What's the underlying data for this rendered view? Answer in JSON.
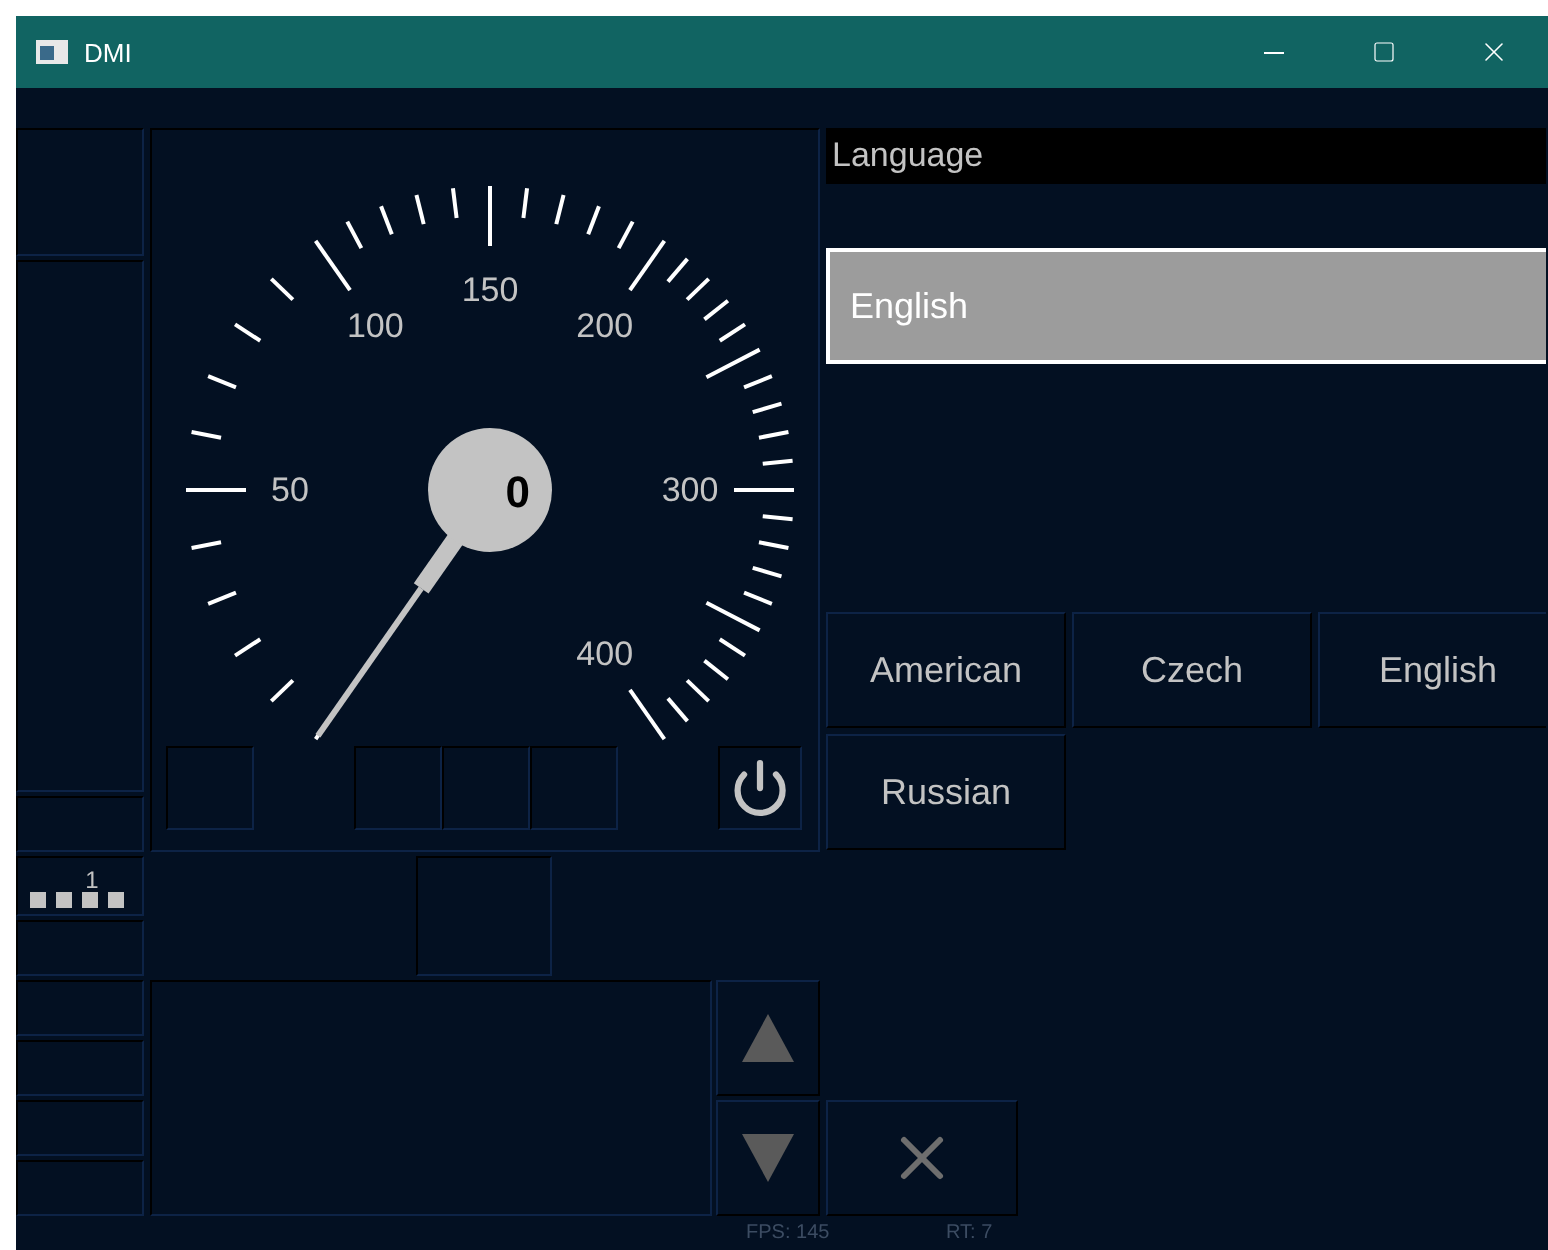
{
  "window": {
    "title": "DMI"
  },
  "speedometer": {
    "scale_labels": [
      "50",
      "100",
      "150",
      "200",
      "300",
      "400"
    ],
    "speed": "0"
  },
  "level_indicator": {
    "label": "1"
  },
  "language_menu": {
    "title": "Language",
    "value": "English",
    "options": [
      "American",
      "Czech",
      "English",
      "Russian"
    ]
  },
  "status_bar": {
    "fps": "FPS: 145",
    "rt": "RT: 7"
  }
}
